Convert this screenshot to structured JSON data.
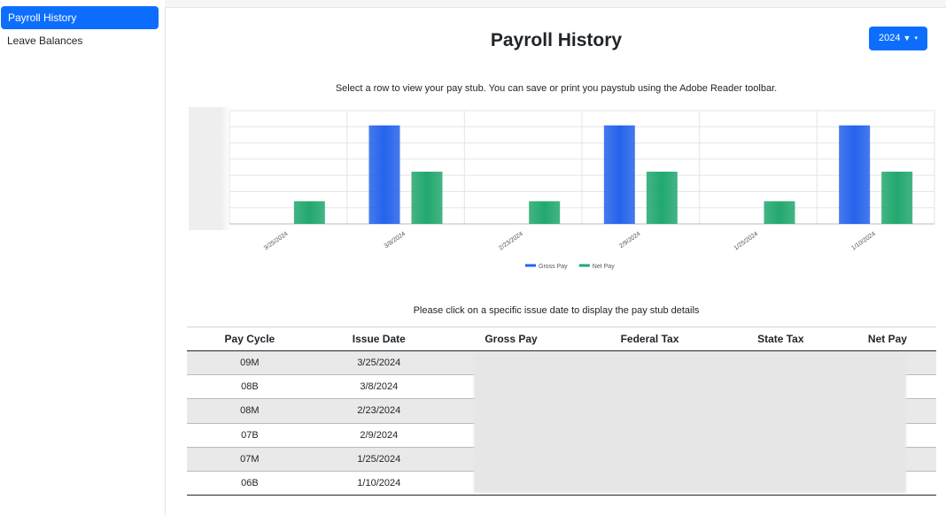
{
  "sidebar": {
    "items": [
      {
        "label": "Payroll History",
        "active": true
      },
      {
        "label": "Leave Balances",
        "active": false
      }
    ]
  },
  "header": {
    "title": "Payroll History",
    "year_button": {
      "label": "2024",
      "icons": [
        "filter-icon",
        "caret-down-icon"
      ]
    }
  },
  "instructions": "Select a row to view your pay stub. You can save or print you paystub using the Adobe Reader toolbar.",
  "chart_data": {
    "type": "bar",
    "categories": [
      "3/25/2024",
      "3/8/2024",
      "2/23/2024",
      "2/9/2024",
      "1/25/2024",
      "1/10/2024"
    ],
    "series": [
      {
        "name": "Gross Pay",
        "color": "#2563eb",
        "values": [
          0,
          100,
          0,
          100,
          0,
          100
        ]
      },
      {
        "name": "Net Pay",
        "color": "#22a86f",
        "values": [
          23,
          53,
          23,
          53,
          23,
          53
        ]
      }
    ],
    "ylim": [
      0,
      115
    ],
    "grid": true,
    "legend": "bottom"
  },
  "click_note": "Please click on a specific issue date to display the pay stub details",
  "table": {
    "columns": [
      "Pay Cycle",
      "Issue Date",
      "Gross Pay",
      "Federal Tax",
      "State Tax",
      "Net Pay"
    ],
    "rows": [
      {
        "cycle": "09M",
        "date": "3/25/2024"
      },
      {
        "cycle": "08B",
        "date": "3/8/2024"
      },
      {
        "cycle": "08M",
        "date": "2/23/2024"
      },
      {
        "cycle": "07B",
        "date": "2/9/2024"
      },
      {
        "cycle": "07M",
        "date": "1/25/2024"
      },
      {
        "cycle": "06B",
        "date": "1/10/2024"
      }
    ]
  },
  "colors": {
    "accent": "#0d6efd",
    "gross": "#2563eb",
    "net": "#22a86f"
  }
}
